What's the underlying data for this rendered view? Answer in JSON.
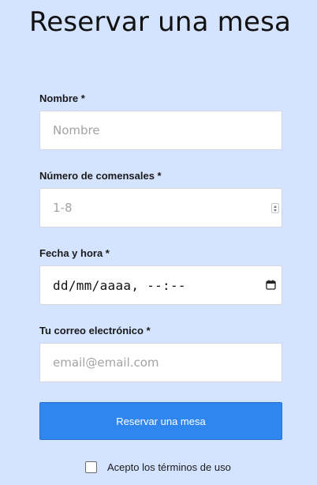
{
  "form": {
    "title": "Reservar una mesa",
    "name_field": {
      "label": "Nombre *",
      "placeholder": "Nombre"
    },
    "guests_field": {
      "label": "Número de comensales *",
      "placeholder": "1-8"
    },
    "datetime_field": {
      "label": "Fecha y hora *",
      "value": "dd/mm/aaaa, --:--"
    },
    "email_field": {
      "label": "Tu correo electrónico *",
      "placeholder": "email@email.com"
    },
    "submit_label": "Reservar una mesa",
    "terms_label": "Acepto los términos de uso",
    "terms_checked": false
  },
  "icons": {
    "datetime": "calendar-icon",
    "guests": "number-spinner-icon"
  },
  "colors": {
    "background": "#d4e3ff",
    "button": "#2f86ef",
    "field": "#ffffff"
  }
}
